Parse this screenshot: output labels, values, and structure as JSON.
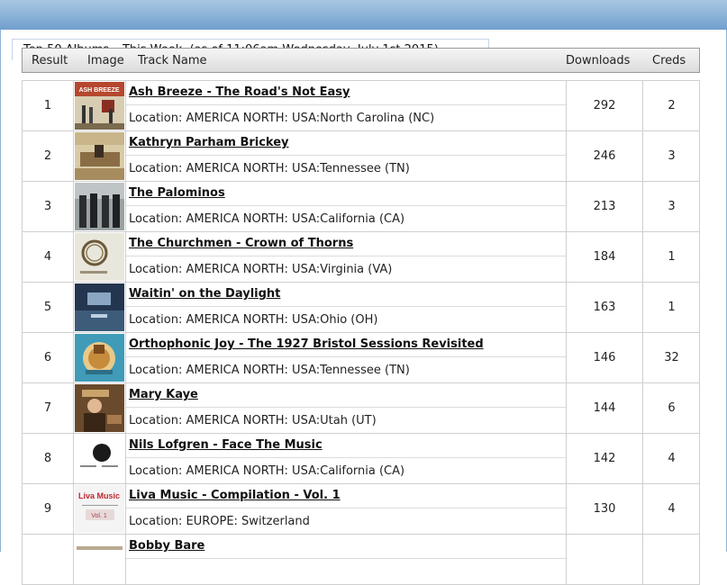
{
  "tab_title": "Top 50 Albums – This Week, (as of 11:06am Wednesday, July 1st 2015)",
  "columns": {
    "result": "Result",
    "image": "Image",
    "track": "Track Name",
    "downloads": "Downloads",
    "creds": "Creds"
  },
  "rows": [
    {
      "rank": "1",
      "title": "Ash Breeze - The Road's Not Easy",
      "location": "Location: AMERICA NORTH: USA:North Carolina (NC)",
      "downloads": "292",
      "creds": "2",
      "thumb": "ash-breeze-cover"
    },
    {
      "rank": "2",
      "title": "Kathryn Parham Brickey",
      "location": "Location: AMERICA NORTH: USA:Tennessee (TN)",
      "downloads": "246",
      "creds": "3",
      "thumb": "kathryn-brickey-cover"
    },
    {
      "rank": "3",
      "title": "The Palominos",
      "location": "Location: AMERICA NORTH: USA:California (CA)",
      "downloads": "213",
      "creds": "3",
      "thumb": "palominos-cover"
    },
    {
      "rank": "4",
      "title": "The Churchmen - Crown of Thorns",
      "location": "Location: AMERICA NORTH: USA:Virginia (VA)",
      "downloads": "184",
      "creds": "1",
      "thumb": "churchmen-cover"
    },
    {
      "rank": "5",
      "title": "Waitin' on the Daylight",
      "location": "Location: AMERICA NORTH: USA:Ohio (OH)",
      "downloads": "163",
      "creds": "1",
      "thumb": "waitin-cover"
    },
    {
      "rank": "6",
      "title": "Orthophonic Joy - The 1927 Bristol Sessions Revisited",
      "location": "Location: AMERICA NORTH: USA:Tennessee (TN)",
      "downloads": "146",
      "creds": "32",
      "thumb": "orthophonic-joy-cover"
    },
    {
      "rank": "7",
      "title": "Mary Kaye",
      "location": "Location: AMERICA NORTH: USA:Utah (UT)",
      "downloads": "144",
      "creds": "6",
      "thumb": "mary-kaye-cover"
    },
    {
      "rank": "8",
      "title": "Nils Lofgren - Face The Music",
      "location": "Location: AMERICA NORTH: USA:California (CA)",
      "downloads": "142",
      "creds": "4",
      "thumb": "nils-lofgren-cover"
    },
    {
      "rank": "9",
      "title": "Liva Music - Compilation - Vol. 1",
      "location": "Location: EUROPE: Switzerland",
      "downloads": "130",
      "creds": "4",
      "thumb": "liva-music-cover"
    },
    {
      "rank": "",
      "title": "Bobby Bare",
      "location": "",
      "downloads": "",
      "creds": "",
      "thumb": "bobby-bare-cover"
    }
  ],
  "thumb_text": {
    "ash": "ASH BREEZE",
    "liva_brand": "Liva Music",
    "liva_vol": "Vol. 1"
  }
}
